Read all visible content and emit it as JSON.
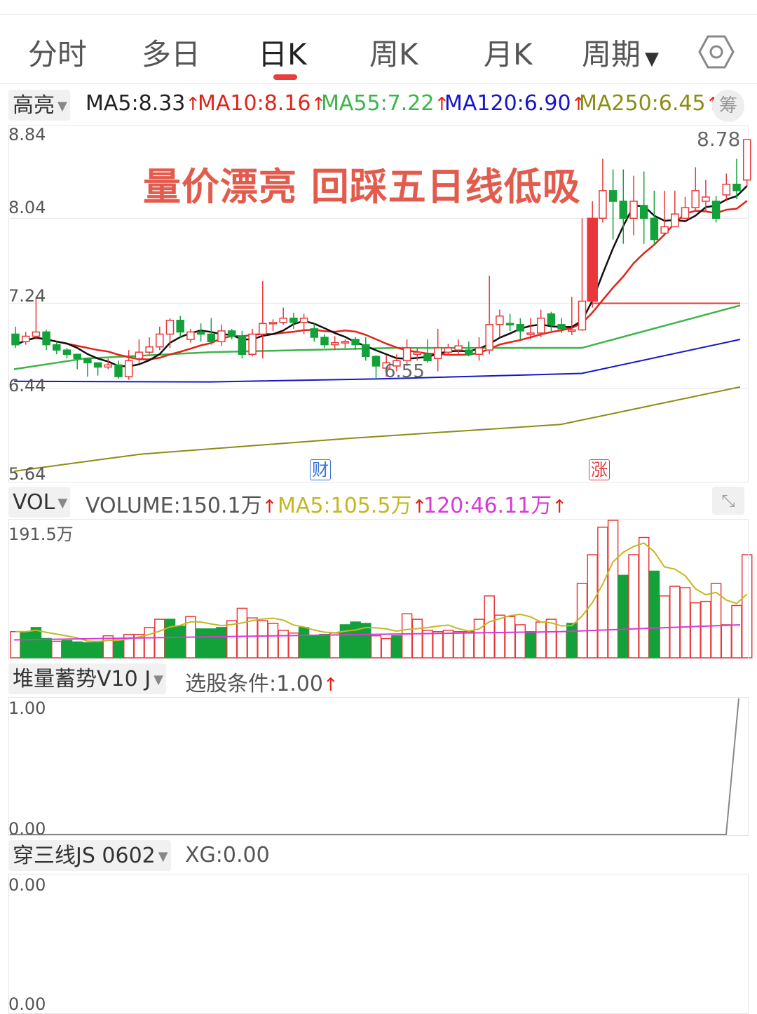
{
  "tabs": [
    {
      "label": "分时"
    },
    {
      "label": "多日"
    },
    {
      "label": "日K"
    },
    {
      "label": "周K"
    },
    {
      "label": "月K"
    },
    {
      "label": "周期"
    }
  ],
  "icons": {
    "settings": "hexagon-settings-icon",
    "dropdown": "caret-down-icon",
    "expand": "expand-arrows-icon"
  },
  "colors": {
    "up": "#e8383a",
    "down": "#13a13a",
    "ma5": "#111111",
    "ma10": "#e2231a",
    "ma55": "#3cb449",
    "ma120": "#1616c8",
    "ma250": "#8c8c14",
    "vol_ma5": "#c3b820",
    "vol_ma120": "#d63ad6"
  },
  "indicator_bar": {
    "selector": "高亮",
    "ma5": "MA5:8.33",
    "ma10": "MA10:8.16",
    "ma55": "MA55:7.22",
    "ma120": "MA120:6.90",
    "ma250": "MA250:6.45",
    "arrow": "↑",
    "chip_button": "筹"
  },
  "main_chart": {
    "y_ticks": [
      "8.84",
      "8.04",
      "7.24",
      "6.44",
      "5.64"
    ],
    "annotation": "量价漂亮 回踩五日线低吸",
    "high_label": "8.78",
    "low_label": "6.55",
    "badge_finance": "财",
    "badge_limit": "涨"
  },
  "volume_bar": {
    "selector": "VOL",
    "volume": "VOLUME:150.1万",
    "ma5": "MA5:105.5万",
    "ma120": "120:46.11万",
    "arrow": "↑",
    "y_top": "191.5万"
  },
  "stack_panel": {
    "selector": "堆量蓄势V10 J",
    "value": "选股条件:1.00",
    "arrow": "↑",
    "y_top": "1.00",
    "y_bottom": "0.00"
  },
  "cross_panel": {
    "selector": "穿三线JS 0602",
    "value": "XG:0.00",
    "y_top": "0.00",
    "y_bottom": "0.00"
  },
  "chart_data": {
    "type": "candlestick",
    "ylim": [
      5.64,
      8.84
    ],
    "candles": [
      [
        6.95,
        6.85,
        7.02,
        6.82
      ],
      [
        6.88,
        6.93,
        6.97,
        6.85
      ],
      [
        6.93,
        6.97,
        7.3,
        6.9
      ],
      [
        6.97,
        6.85,
        6.99,
        6.8
      ],
      [
        6.85,
        6.8,
        6.88,
        6.76
      ],
      [
        6.8,
        6.76,
        6.82,
        6.72
      ],
      [
        6.76,
        6.72,
        6.76,
        6.62
      ],
      [
        6.72,
        6.68,
        6.72,
        6.55
      ],
      [
        6.68,
        6.64,
        6.68,
        6.56
      ],
      [
        6.64,
        6.66,
        6.72,
        6.62
      ],
      [
        6.66,
        6.55,
        6.7,
        6.53
      ],
      [
        6.55,
        6.7,
        6.8,
        6.52
      ],
      [
        6.72,
        6.78,
        6.9,
        6.68
      ],
      [
        6.78,
        6.83,
        6.92,
        6.76
      ],
      [
        6.83,
        6.95,
        7.02,
        6.8
      ],
      [
        6.95,
        7.08,
        7.1,
        6.82
      ],
      [
        7.08,
        6.97,
        7.12,
        6.92
      ],
      [
        6.9,
        6.97,
        7.0,
        6.87
      ],
      [
        6.97,
        6.95,
        7.05,
        6.88
      ],
      [
        6.95,
        6.88,
        7.1,
        6.85
      ],
      [
        6.88,
        6.98,
        7.04,
        6.84
      ],
      [
        6.98,
        6.93,
        7.0,
        6.9
      ],
      [
        6.93,
        6.76,
        6.98,
        6.72
      ],
      [
        6.76,
        6.95,
        7.0,
        6.74
      ],
      [
        6.95,
        7.05,
        7.45,
        6.72
      ],
      [
        7.05,
        7.06,
        7.09,
        6.98
      ],
      [
        7.06,
        7.1,
        7.2,
        7.04
      ],
      [
        7.1,
        7.06,
        7.15,
        7.0
      ],
      [
        7.06,
        7.1,
        7.14,
        6.95
      ],
      [
        7.0,
        6.92,
        7.05,
        6.88
      ],
      [
        6.92,
        6.85,
        6.95,
        6.82
      ],
      [
        6.85,
        6.87,
        6.93,
        6.8
      ],
      [
        6.88,
        6.88,
        6.9,
        6.82
      ],
      [
        6.9,
        6.85,
        6.92,
        6.8
      ],
      [
        6.85,
        6.74,
        6.92,
        6.7
      ],
      [
        6.74,
        6.65,
        6.75,
        6.52
      ],
      [
        6.63,
        6.68,
        6.75,
        6.55
      ],
      [
        6.65,
        6.7,
        6.76,
        6.6
      ],
      [
        6.7,
        6.82,
        6.9,
        6.65
      ],
      [
        6.76,
        6.78,
        6.82,
        6.7
      ],
      [
        6.76,
        6.7,
        6.9,
        6.68
      ],
      [
        6.72,
        6.82,
        7.0,
        6.6
      ],
      [
        6.78,
        6.82,
        6.86,
        6.75
      ],
      [
        6.8,
        6.84,
        6.9,
        6.76
      ],
      [
        6.8,
        6.76,
        6.88,
        6.74
      ],
      [
        6.76,
        6.82,
        6.92,
        6.7
      ],
      [
        6.8,
        7.04,
        7.5,
        6.76
      ],
      [
        7.04,
        7.12,
        7.18,
        6.92
      ],
      [
        7.05,
        7.04,
        7.14,
        6.98
      ],
      [
        7.04,
        6.98,
        7.1,
        6.9
      ],
      [
        6.96,
        6.96,
        7.1,
        6.9
      ],
      [
        6.96,
        7.1,
        7.18,
        6.92
      ],
      [
        7.14,
        7.04,
        7.16,
        6.98
      ],
      [
        7.04,
        7.0,
        7.1,
        6.96
      ],
      [
        6.99,
        6.99,
        7.3,
        6.94
      ],
      [
        6.99,
        7.26,
        8.04,
        6.98
      ],
      [
        7.26,
        8.04,
        8.2,
        7.2
      ],
      [
        8.04,
        8.3,
        8.6,
        8.0
      ],
      [
        8.3,
        8.2,
        8.5,
        7.84
      ],
      [
        8.2,
        8.04,
        8.5,
        7.8
      ],
      [
        8.04,
        8.2,
        8.44,
        7.88
      ],
      [
        8.16,
        8.04,
        8.48,
        7.8
      ],
      [
        8.04,
        7.84,
        8.3,
        7.78
      ],
      [
        7.9,
        7.96,
        8.3,
        7.9
      ],
      [
        7.96,
        8.08,
        8.3,
        7.98
      ],
      [
        8.04,
        8.14,
        8.24,
        8.08
      ],
      [
        8.14,
        8.3,
        8.52,
        8.1
      ],
      [
        8.2,
        8.24,
        8.4,
        8.1
      ],
      [
        8.2,
        8.04,
        8.25,
        8.0
      ],
      [
        8.26,
        8.36,
        8.46,
        8.2
      ],
      [
        8.36,
        8.3,
        8.6,
        8.22
      ],
      [
        8.4,
        8.78,
        8.78,
        8.34
      ]
    ],
    "volumes": [
      [
        38,
        0
      ],
      [
        38,
        1
      ],
      [
        44,
        1
      ],
      [
        28,
        1
      ],
      [
        24,
        0
      ],
      [
        25,
        1
      ],
      [
        23,
        1
      ],
      [
        22,
        1
      ],
      [
        24,
        1
      ],
      [
        32,
        0
      ],
      [
        26,
        1
      ],
      [
        34,
        0
      ],
      [
        34,
        0
      ],
      [
        44,
        0
      ],
      [
        56,
        0
      ],
      [
        56,
        1
      ],
      [
        46,
        1
      ],
      [
        60,
        0
      ],
      [
        42,
        1
      ],
      [
        42,
        1
      ],
      [
        44,
        1
      ],
      [
        54,
        0
      ],
      [
        72,
        0
      ],
      [
        58,
        0
      ],
      [
        54,
        0
      ],
      [
        50,
        0
      ],
      [
        40,
        0
      ],
      [
        36,
        0
      ],
      [
        44,
        1
      ],
      [
        32,
        1
      ],
      [
        34,
        1
      ],
      [
        36,
        0
      ],
      [
        48,
        1
      ],
      [
        52,
        1
      ],
      [
        50,
        1
      ],
      [
        32,
        0
      ],
      [
        28,
        0
      ],
      [
        32,
        1
      ],
      [
        64,
        0
      ],
      [
        56,
        0
      ],
      [
        40,
        0
      ],
      [
        38,
        0
      ],
      [
        40,
        0
      ],
      [
        38,
        0
      ],
      [
        38,
        0
      ],
      [
        56,
        0
      ],
      [
        90,
        0
      ],
      [
        62,
        0
      ],
      [
        60,
        0
      ],
      [
        48,
        0
      ],
      [
        38,
        1
      ],
      [
        52,
        0
      ],
      [
        56,
        0
      ],
      [
        38,
        0
      ],
      [
        50,
        1
      ],
      [
        108,
        0
      ],
      [
        150,
        0
      ],
      [
        190,
        0
      ],
      [
        200,
        0
      ],
      [
        120,
        1
      ],
      [
        150,
        0
      ],
      [
        175,
        0
      ],
      [
        126,
        1
      ],
      [
        90,
        0
      ],
      [
        104,
        0
      ],
      [
        102,
        0
      ],
      [
        80,
        0
      ],
      [
        82,
        0
      ],
      [
        108,
        0
      ],
      [
        48,
        0
      ],
      [
        76,
        0
      ],
      [
        150,
        0
      ]
    ]
  }
}
